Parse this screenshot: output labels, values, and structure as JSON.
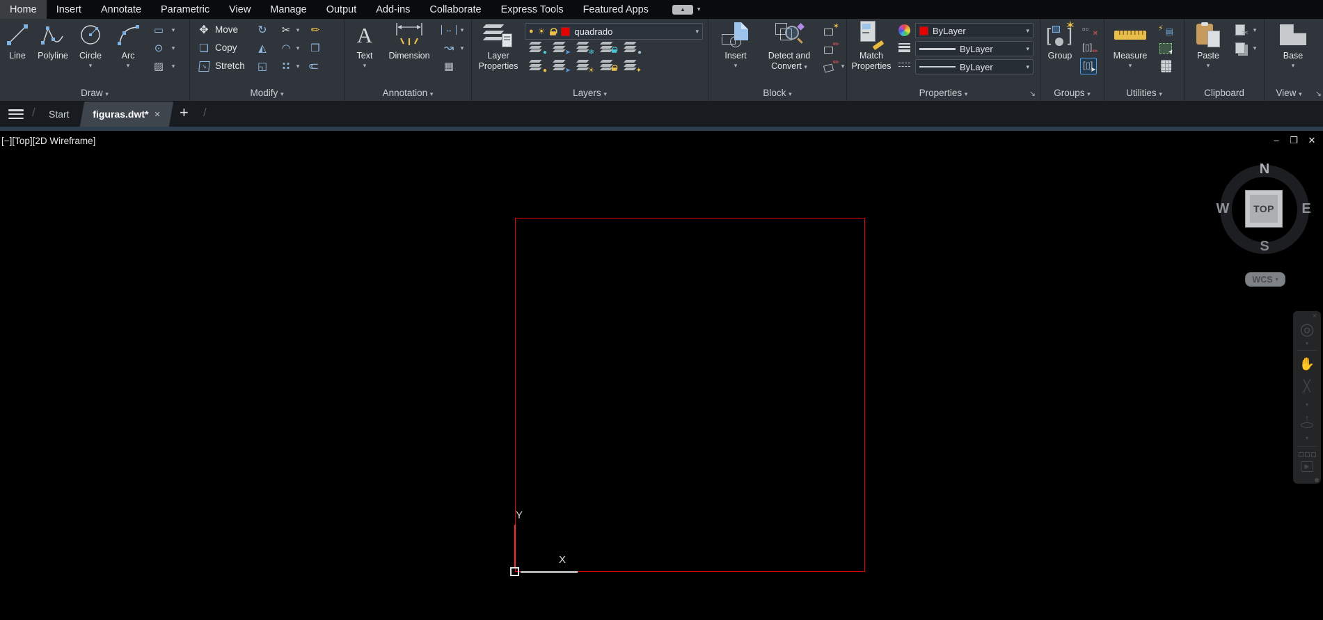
{
  "colors": {
    "square_red": "#e60000",
    "layer_swatch_red": "#e60000",
    "accent_blue": "#4da0e8",
    "icon_yellow": "#ecc04a",
    "icon_cyan": "#49c6d8",
    "icon_purple": "#b18ce6",
    "ribbon_bg": "#30353b",
    "viewport_bg": "#000000"
  },
  "icons": {
    "caret": "▾",
    "launcher": "↘",
    "move": "✥",
    "rotate": "↻",
    "trim": "✂",
    "erase": "✏",
    "copy_obj": "❏",
    "mirror": "◭",
    "fillet": "◠",
    "explode": "❒",
    "scale": "◱",
    "array": "∷",
    "offset": "⊂",
    "rect": "▭",
    "ellipse": "⊙",
    "hatch": "▨",
    "text_glyph": "A",
    "harrow": "↔",
    "leader": "↝",
    "table": "▦",
    "bulb": "●",
    "sun": "☀",
    "snowflake": "❄",
    "arrow": "➤",
    "sparkle": "✦",
    "star": "✶",
    "pencil": "✏",
    "diamond": "◆",
    "cross_red": "✕",
    "stretch_arrow": "↘",
    "hand": "✋",
    "wheel": "◎",
    "play": "▶",
    "zoom_cross": "╳",
    "zoom_lens": "○",
    "orbit_arrow": "↑",
    "minimize": "–",
    "restore": "❐",
    "close": "✕",
    "plus": "+",
    "slash": "/",
    "lightning": "⚡",
    "list": "▤",
    "up_triangle": "▲",
    "cut": "✂",
    "ball": "●"
  },
  "menu": {
    "items": [
      "Home",
      "Insert",
      "Annotate",
      "Parametric",
      "View",
      "Manage",
      "Output",
      "Add-ins",
      "Collaborate",
      "Express Tools",
      "Featured Apps"
    ]
  },
  "ribbon": {
    "draw": {
      "label": "Draw",
      "line": "Line",
      "polyline": "Polyline",
      "circle": "Circle",
      "arc": "Arc"
    },
    "modify": {
      "label": "Modify",
      "move": "Move",
      "copy": "Copy",
      "stretch": "Stretch"
    },
    "annotation": {
      "label": "Annotation",
      "text": "Text",
      "dimension": "Dimension"
    },
    "layers": {
      "label": "Layers",
      "layer_properties": [
        "Layer",
        "Properties"
      ],
      "current_layer": "quadrado"
    },
    "block": {
      "label": "Block",
      "insert": "Insert",
      "detect": [
        "Detect and",
        "Convert"
      ]
    },
    "properties": {
      "label": "Properties",
      "match": [
        "Match",
        "Properties"
      ],
      "color": "ByLayer",
      "lineweight": "ByLayer",
      "linetype": "ByLayer"
    },
    "groups": {
      "label": "Groups",
      "group": "Group"
    },
    "utilities": {
      "label": "Utilities",
      "measure": "Measure"
    },
    "clipboard": {
      "label": "Clipboard",
      "paste": "Paste"
    },
    "view": {
      "label": "View",
      "base": "Base"
    }
  },
  "tabs": {
    "start": "Start",
    "active": "figuras.dwt*"
  },
  "viewport": {
    "label": "[−][Top][2D Wireframe]",
    "viewcube": {
      "n": "N",
      "e": "E",
      "s": "S",
      "w": "W",
      "face": "TOP",
      "wcs": "WCS"
    },
    "ucs": {
      "x": "X",
      "y": "Y"
    }
  }
}
